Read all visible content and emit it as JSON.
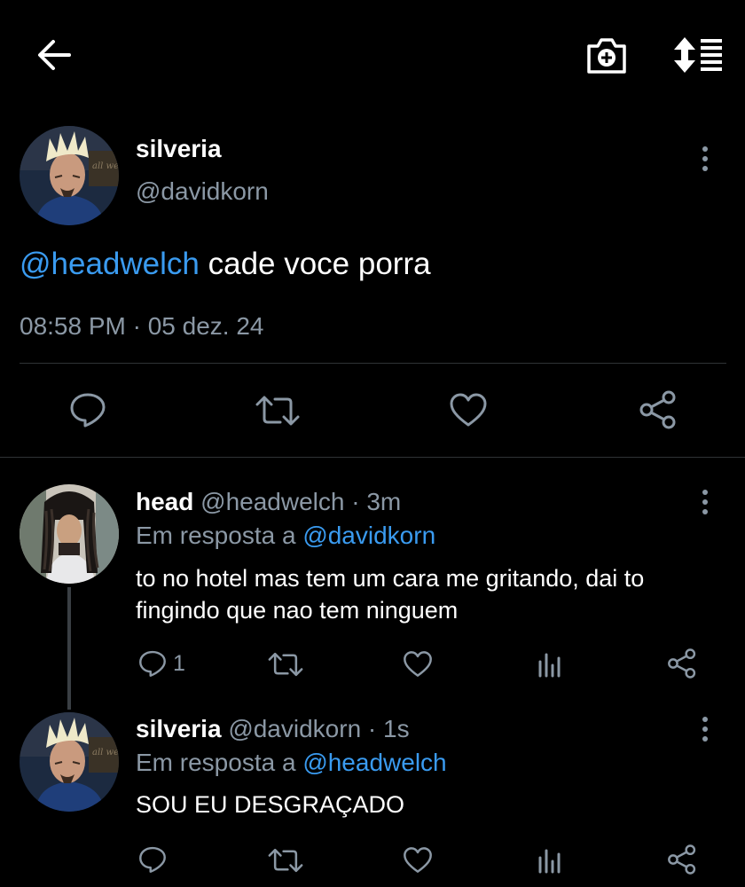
{
  "header": {
    "back_icon": "arrow-left-icon",
    "camera_icon": "camera-plus-icon",
    "sort_icon": "sort-list-icon"
  },
  "main_tweet": {
    "display_name": "silveria",
    "handle": "@davidkorn",
    "mention": "@headwelch",
    "text": " cade voce porra",
    "timestamp": "08:58 PM · 05 dez. 24"
  },
  "replies": [
    {
      "display_name": "head",
      "handle": "@headwelch",
      "time": " · 3m",
      "reply_prefix": "Em resposta a ",
      "reply_to": "@davidkorn",
      "text": "to no hotel mas tem um cara me gritando, dai to fingindo que nao tem ninguem",
      "reply_count": "1"
    },
    {
      "display_name": "silveria",
      "handle": "@davidkorn",
      "time": " · 1s",
      "reply_prefix": "Em resposta a ",
      "reply_to": "@headwelch",
      "text": "SOU EU DESGRAÇADO"
    }
  ],
  "colors": {
    "background": "#000000",
    "text": "#ffffff",
    "secondary": "#8b98a5",
    "link": "#3a9bf0",
    "divider": "#2f3336"
  }
}
